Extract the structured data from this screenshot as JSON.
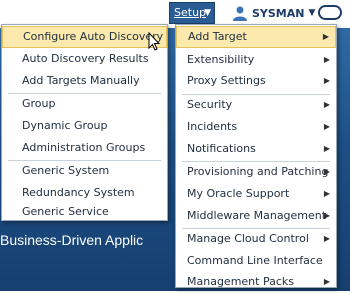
{
  "topbar": {
    "setup_label": "Setup",
    "user_name": "SYSMAN"
  },
  "background": {
    "headline": "Business-Driven Applic"
  },
  "setup_menu": {
    "items": [
      {
        "label": "Configure Auto Discovery"
      },
      {
        "label": "Auto Discovery Results"
      },
      {
        "label": "Add Targets Manually"
      },
      {
        "label": "Group"
      },
      {
        "label": "Dynamic Group"
      },
      {
        "label": "Administration Groups"
      },
      {
        "label": "Generic System"
      },
      {
        "label": "Redundancy System"
      },
      {
        "label": "Generic Service"
      }
    ]
  },
  "submenu": {
    "items": [
      {
        "label": "Add Target"
      },
      {
        "label": "Extensibility"
      },
      {
        "label": "Proxy Settings"
      },
      {
        "label": "Security"
      },
      {
        "label": "Incidents"
      },
      {
        "label": "Notifications"
      },
      {
        "label": "Provisioning and Patching"
      },
      {
        "label": "My Oracle Support"
      },
      {
        "label": "Middleware Management"
      },
      {
        "label": "Manage Cloud Control"
      },
      {
        "label": "Command Line Interface"
      },
      {
        "label": "Management Packs"
      }
    ]
  },
  "colors": {
    "highlight": "#fbe9ad",
    "menu_bg": "#ffffff",
    "header_button": "#2a5c94"
  }
}
